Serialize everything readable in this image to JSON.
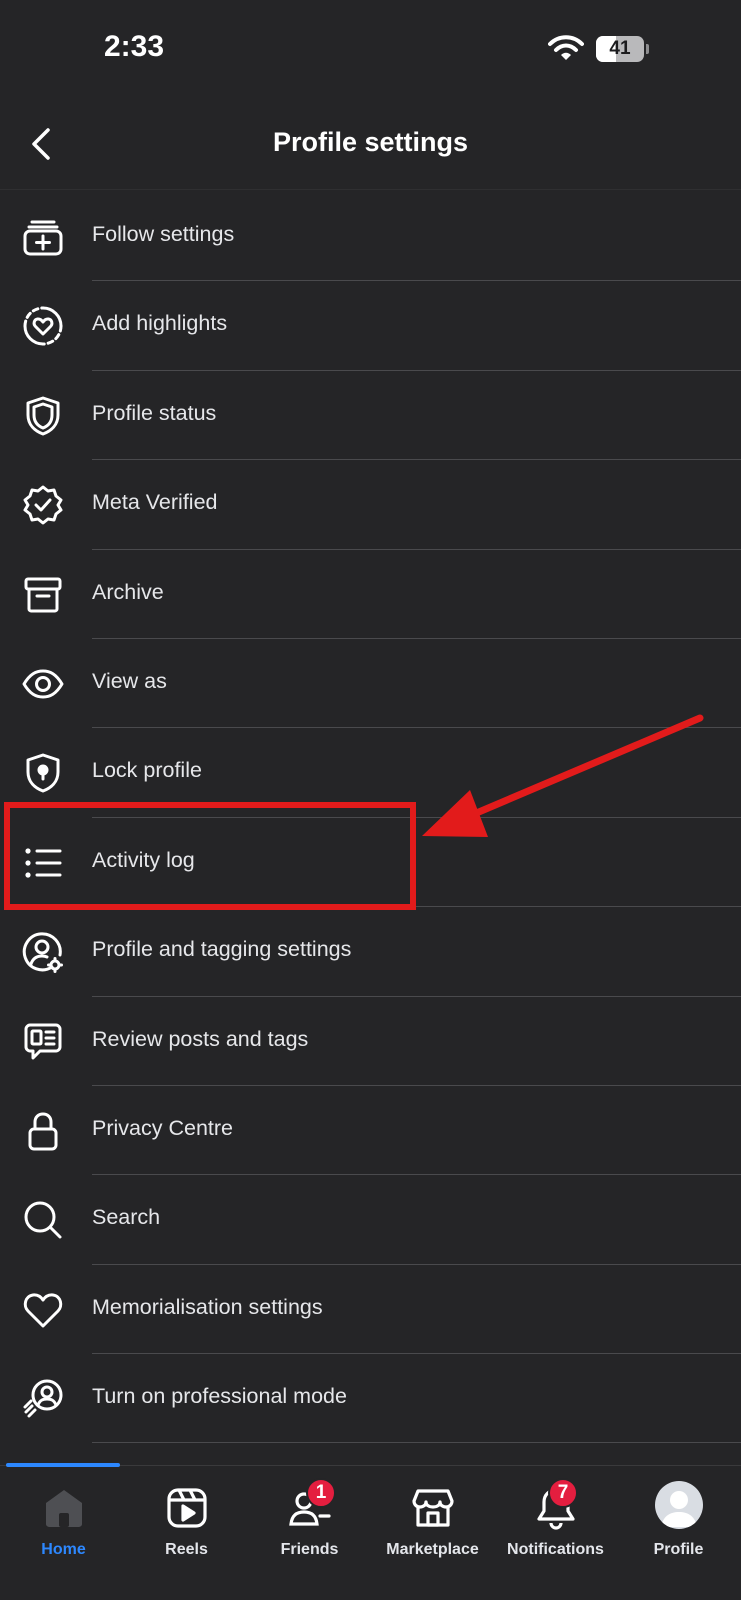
{
  "status_bar": {
    "time": "2:33",
    "battery": "41",
    "battery_level": 0.41
  },
  "header": {
    "title": "Profile settings",
    "back_icon": "chevron-left-icon"
  },
  "settings": [
    {
      "label": "Follow settings",
      "icon": "follow-icon"
    },
    {
      "label": "Add highlights",
      "icon": "highlights-heart-icon"
    },
    {
      "label": "Profile status",
      "icon": "shield-icon"
    },
    {
      "label": "Meta Verified",
      "icon": "verified-badge-icon"
    },
    {
      "label": "Archive",
      "icon": "archive-box-icon"
    },
    {
      "label": "View as",
      "icon": "eye-icon"
    },
    {
      "label": "Lock profile",
      "icon": "lock-shield-icon"
    },
    {
      "label": "Activity log",
      "icon": "list-icon"
    },
    {
      "label": "Profile and tagging settings",
      "icon": "user-gear-icon"
    },
    {
      "label": "Review posts and tags",
      "icon": "review-posts-icon"
    },
    {
      "label": "Privacy Centre",
      "icon": "padlock-icon"
    },
    {
      "label": "Search",
      "icon": "search-icon"
    },
    {
      "label": "Memorialisation settings",
      "icon": "heart-icon"
    },
    {
      "label": "Turn on professional mode",
      "icon": "professional-mode-icon"
    }
  ],
  "nav": [
    {
      "label": "Home",
      "icon": "home-icon",
      "active": true
    },
    {
      "label": "Reels",
      "icon": "reels-icon"
    },
    {
      "label": "Friends",
      "icon": "friends-icon",
      "badge": "1"
    },
    {
      "label": "Marketplace",
      "icon": "marketplace-icon"
    },
    {
      "label": "Notifications",
      "icon": "bell-icon",
      "badge": "7"
    },
    {
      "label": "Profile",
      "icon": "avatar-icon"
    }
  ],
  "colors": {
    "background": "#252527",
    "accent": "#2d88ff",
    "badge": "#e41e3f",
    "annotation": "#e21b1b"
  }
}
